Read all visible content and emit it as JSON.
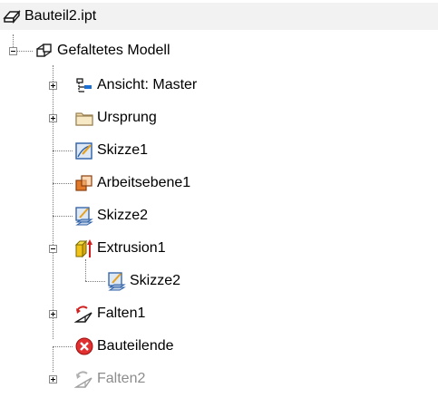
{
  "tree": {
    "root": {
      "label": "Bauteil2.ipt",
      "icon": "part-file-icon"
    },
    "model": {
      "label": "Gefaltetes Modell",
      "icon": "folded-model-icon"
    },
    "items": [
      {
        "label": "Ansicht: Master",
        "icon": "view-rep-icon",
        "toggle": "plus"
      },
      {
        "label": "Ursprung",
        "icon": "folder-icon",
        "toggle": "plus"
      },
      {
        "label": "Skizze1",
        "icon": "sketch-icon",
        "toggle": "none"
      },
      {
        "label": "Arbeitsebene1",
        "icon": "work-plane-icon",
        "toggle": "none"
      },
      {
        "label": "Skizze2",
        "icon": "shared-sketch-icon",
        "toggle": "none"
      },
      {
        "label": "Extrusion1",
        "icon": "extrusion-icon",
        "toggle": "minus"
      },
      {
        "label": "Skizze2",
        "icon": "shared-sketch-icon",
        "toggle": "none"
      },
      {
        "label": "Falten1",
        "icon": "fold-icon",
        "toggle": "plus"
      },
      {
        "label": "Bauteilende",
        "icon": "end-of-part-icon",
        "toggle": "none"
      },
      {
        "label": "Falten2",
        "icon": "fold-suppressed-icon",
        "toggle": "plus"
      }
    ]
  },
  "colors": {
    "selected_row_bg": "#f2f2f2",
    "suppressed_text": "#8c8c8c",
    "end_of_part": "#e03030"
  }
}
